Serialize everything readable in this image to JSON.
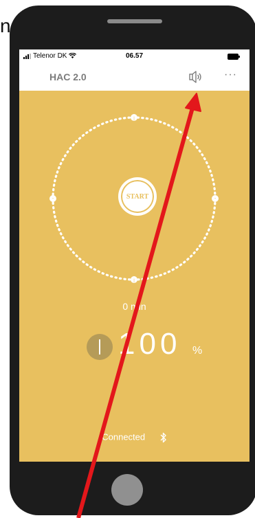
{
  "stray_text": "n",
  "status_bar": {
    "carrier": "Telenor DK",
    "time": "06.57"
  },
  "header": {
    "title": "HAC 2.0",
    "sound_icon": "speaker-icon",
    "menu_icon": "more-dots-icon",
    "menu_glyph": "···"
  },
  "timer": {
    "start_label": "START",
    "duration_text": "0 min"
  },
  "level": {
    "value": "100",
    "unit": "%"
  },
  "connection": {
    "status_text": "Connected",
    "icon": "bluetooth-icon"
  },
  "colors": {
    "screen_background": "#e8c05f",
    "phone_body": "#1c1c1c",
    "arrow": "#e3171b",
    "header_text": "#7b7b7b"
  }
}
